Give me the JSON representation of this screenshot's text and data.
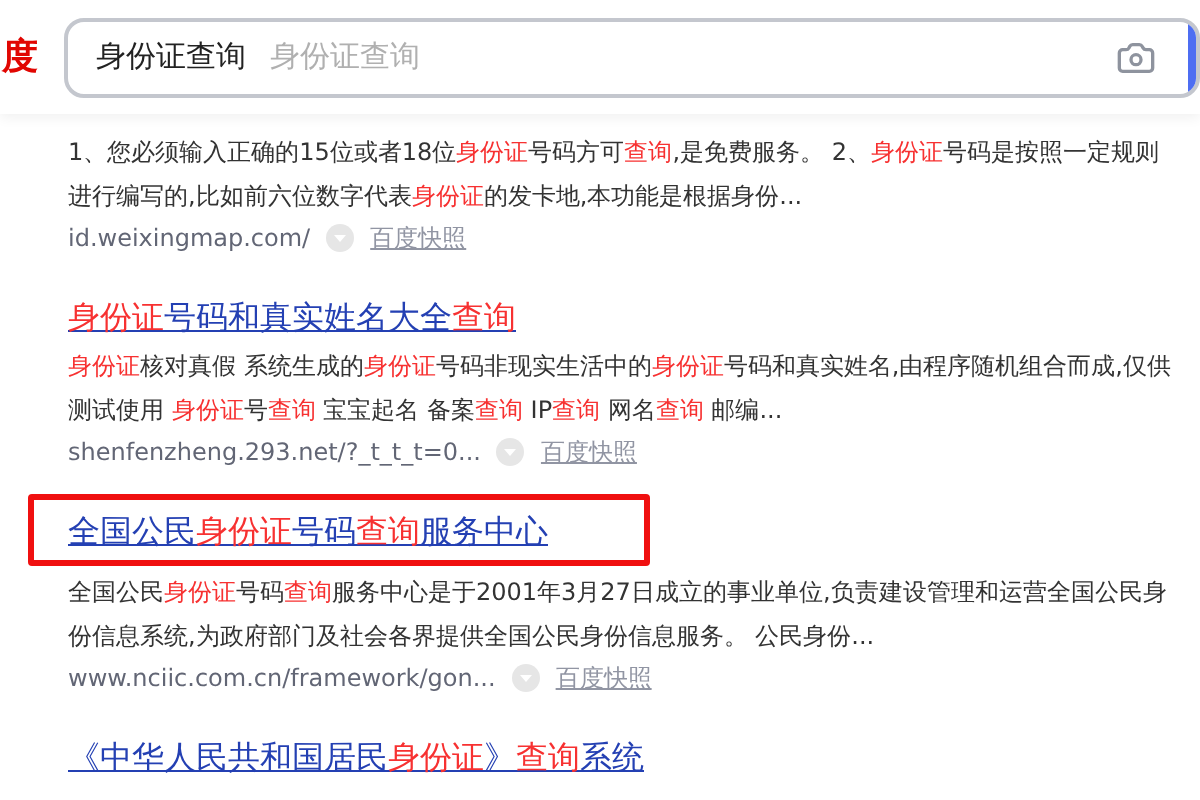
{
  "header": {
    "logo": "度",
    "search": {
      "value": "身份证查询",
      "suggestion": "身份证查询"
    }
  },
  "results": [
    {
      "snippet": [
        {
          "text": "1、您必须输入正确的15位或者18位",
          "hl": false
        },
        {
          "text": "身份证",
          "hl": true
        },
        {
          "text": "号码方可",
          "hl": false
        },
        {
          "text": "查询",
          "hl": true
        },
        {
          "text": ",是免费服务。 2、",
          "hl": false
        },
        {
          "text": "身份证",
          "hl": true
        },
        {
          "text": "号码是按照一定规则进行编写的,比如前六位数字代表",
          "hl": false
        },
        {
          "text": "身份证",
          "hl": true
        },
        {
          "text": "的发卡地,本功能是根据身份...",
          "hl": false
        }
      ],
      "url": "id.weixingmap.com/",
      "snapshot": "百度快照",
      "framed": false
    },
    {
      "title": [
        {
          "text": "身份证",
          "hl": true
        },
        {
          "text": "号码和真实姓名大全",
          "hl": false
        },
        {
          "text": "查询",
          "hl": true
        }
      ],
      "snippet": [
        {
          "text": "身份证",
          "hl": true
        },
        {
          "text": "核对真假 系统生成的",
          "hl": false
        },
        {
          "text": "身份证",
          "hl": true
        },
        {
          "text": "号码非现实生活中的",
          "hl": false
        },
        {
          "text": "身份证",
          "hl": true
        },
        {
          "text": "号码和真实姓名,由程序随机组合而成,仅供测试使用 ",
          "hl": false
        },
        {
          "text": "身份证",
          "hl": true
        },
        {
          "text": "号",
          "hl": false
        },
        {
          "text": "查询",
          "hl": true
        },
        {
          "text": " 宝宝起名 备案",
          "hl": false
        },
        {
          "text": "查询",
          "hl": true
        },
        {
          "text": " IP",
          "hl": false
        },
        {
          "text": "查询",
          "hl": true
        },
        {
          "text": " 网名",
          "hl": false
        },
        {
          "text": "查询",
          "hl": true
        },
        {
          "text": " 邮编...",
          "hl": false
        }
      ],
      "url": "shenfenzheng.293.net/?_t_t_t=0...",
      "snapshot": "百度快照",
      "framed": false
    },
    {
      "title": [
        {
          "text": "全国公民",
          "hl": false
        },
        {
          "text": "身份证",
          "hl": true
        },
        {
          "text": "号码",
          "hl": false
        },
        {
          "text": "查询",
          "hl": true
        },
        {
          "text": "服务中心",
          "hl": false
        }
      ],
      "snippet": [
        {
          "text": "全国公民",
          "hl": false
        },
        {
          "text": "身份证",
          "hl": true
        },
        {
          "text": "号码",
          "hl": false
        },
        {
          "text": "查询",
          "hl": true
        },
        {
          "text": "服务中心是于2001年3月27日成立的事业单位,负责建设管理和运营全国公民身份信息系统,为政府部门及社会各界提供全国公民身份信息服务。 公民身份...",
          "hl": false
        }
      ],
      "url": "www.nciic.com.cn/framework/gon...",
      "snapshot": "百度快照",
      "framed": true
    },
    {
      "title": [
        {
          "text": "《中华人民共和国居民",
          "hl": false
        },
        {
          "text": "身份证",
          "hl": true
        },
        {
          "text": "》",
          "hl": false
        },
        {
          "text": "查询",
          "hl": true
        },
        {
          "text": "系统",
          "hl": false
        }
      ],
      "framed": false
    }
  ]
}
